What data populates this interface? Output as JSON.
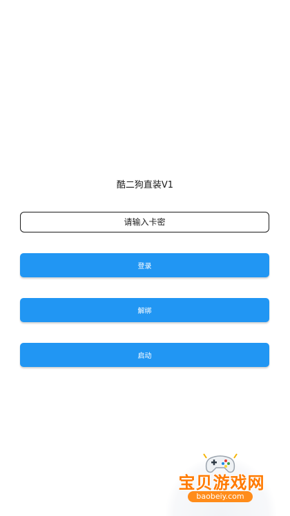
{
  "app": {
    "title": "酷二狗直装V1"
  },
  "card_input": {
    "placeholder": "请输入卡密",
    "value": ""
  },
  "buttons": {
    "login_label": "登录",
    "unbind_label": "解绑",
    "start_label": "启动"
  },
  "watermark": {
    "brand_text": "宝贝游戏网",
    "url_text": "baobeiy.com",
    "icon": "gamepad-icon"
  },
  "colors": {
    "primary": "#2196f3",
    "watermark_orange": "#ff7a00"
  }
}
